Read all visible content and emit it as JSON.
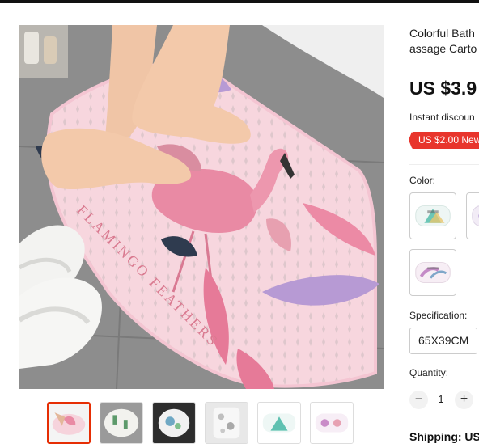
{
  "product": {
    "title_line1": "Colorful Bath",
    "title_line2": "assage Carto",
    "price": "US $3.9",
    "instant_discount": "Instant discoun",
    "coupon": "US $2.00 New",
    "mat_text": "FLAMINGO FEATHERS"
  },
  "options": {
    "color_label": "Color:",
    "color_swatches": [
      {
        "name": "teal-triangle-pattern",
        "selected": false
      },
      {
        "name": "purple-pattern",
        "selected": false
      },
      {
        "name": "feather-pattern",
        "selected": false
      }
    ],
    "spec_label": "Specification:",
    "spec_value": "65X39CM"
  },
  "quantity": {
    "label": "Quantity:",
    "value": "1",
    "minus": "−",
    "plus": "+"
  },
  "shipping": {
    "label": "Shipping: US"
  },
  "gallery": {
    "active_index": 0,
    "thumbnails": [
      "flamingo-mat",
      "cactus-mat",
      "dark-mat",
      "pebble-mat",
      "teal-mat",
      "floral-mat"
    ]
  },
  "colors": {
    "accent": "#e62e04",
    "coupon_bg": "#e8352c",
    "mat_pink": "#f6d3dc",
    "floor_gray": "#8e8e8e"
  }
}
